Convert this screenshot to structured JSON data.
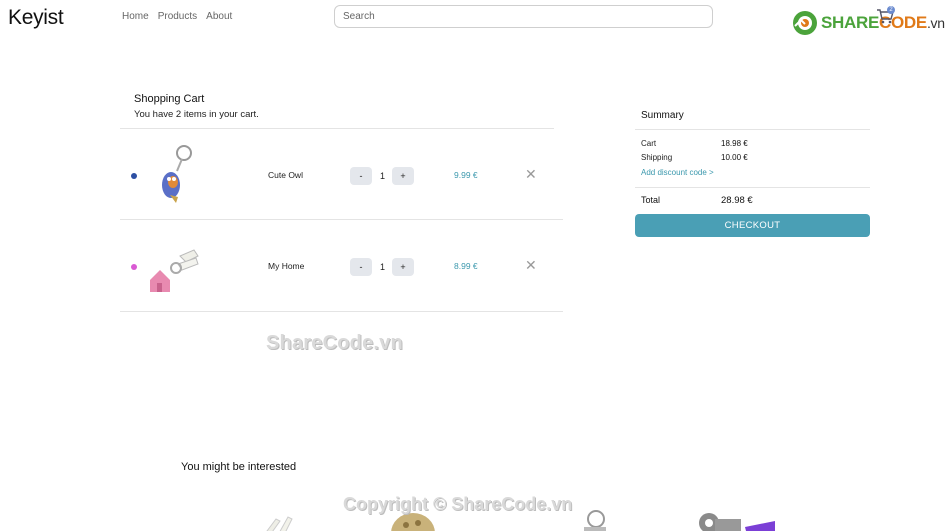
{
  "header": {
    "brand": "Keyist",
    "nav": [
      "Home",
      "Products",
      "About"
    ],
    "search_placeholder": "Search",
    "watermark_logo": {
      "part_a": "SHARE",
      "part_b": "CODE",
      "part_c": ".vn"
    },
    "cart_count": "2"
  },
  "cart": {
    "title": "Shopping Cart",
    "subtitle": "You have 2 items in your cart.",
    "items": [
      {
        "name": "Cute Owl",
        "qty": "1",
        "price": "9.99 €",
        "minus": "-",
        "plus": "+",
        "dot_color": "#2d4fa3",
        "icon": "owl-keychain-image"
      },
      {
        "name": "My Home",
        "qty": "1",
        "price": "8.99 €",
        "minus": "-",
        "plus": "+",
        "dot_color": "#d95ad3",
        "icon": "house-keychain-image"
      }
    ],
    "remove_glyph": "✕"
  },
  "summary": {
    "title": "Summary",
    "cart_label": "Cart",
    "cart_value": "18.98 €",
    "shipping_label": "Shipping",
    "shipping_value": "10.00 €",
    "discount_link": "Add discount code >",
    "total_label": "Total",
    "total_value": "28.98 €",
    "checkout_label": "CHECKOUT"
  },
  "watermarks": {
    "center": "ShareCode.vn",
    "bottom": "Copyright © ShareCode.vn"
  },
  "recommendations": {
    "title": "You might be interested"
  },
  "colors": {
    "accent": "#4a9fb5",
    "price": "#3b98ad",
    "qty_button_bg": "#e4e7ec"
  }
}
